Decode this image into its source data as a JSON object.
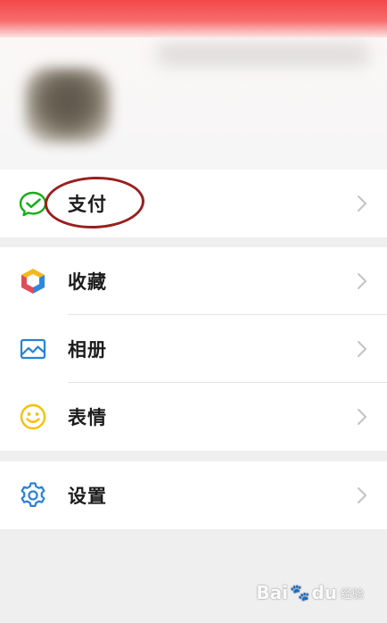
{
  "menu": {
    "pay": {
      "label": "支付",
      "icon": "wechat-pay-icon",
      "color": "#1aad19"
    },
    "favorites": {
      "label": "收藏",
      "icon": "cube-icon"
    },
    "album": {
      "label": "相册",
      "icon": "picture-icon",
      "color": "#2782d7"
    },
    "stickers": {
      "label": "表情",
      "icon": "smiley-icon",
      "color": "#f7c100"
    },
    "settings": {
      "label": "设置",
      "icon": "gear-icon",
      "color": "#2782d7"
    }
  },
  "annotation": {
    "color": "#9a1f1f"
  },
  "watermark": {
    "brand": "Bai",
    "brand2": "du",
    "sub": "经验"
  }
}
